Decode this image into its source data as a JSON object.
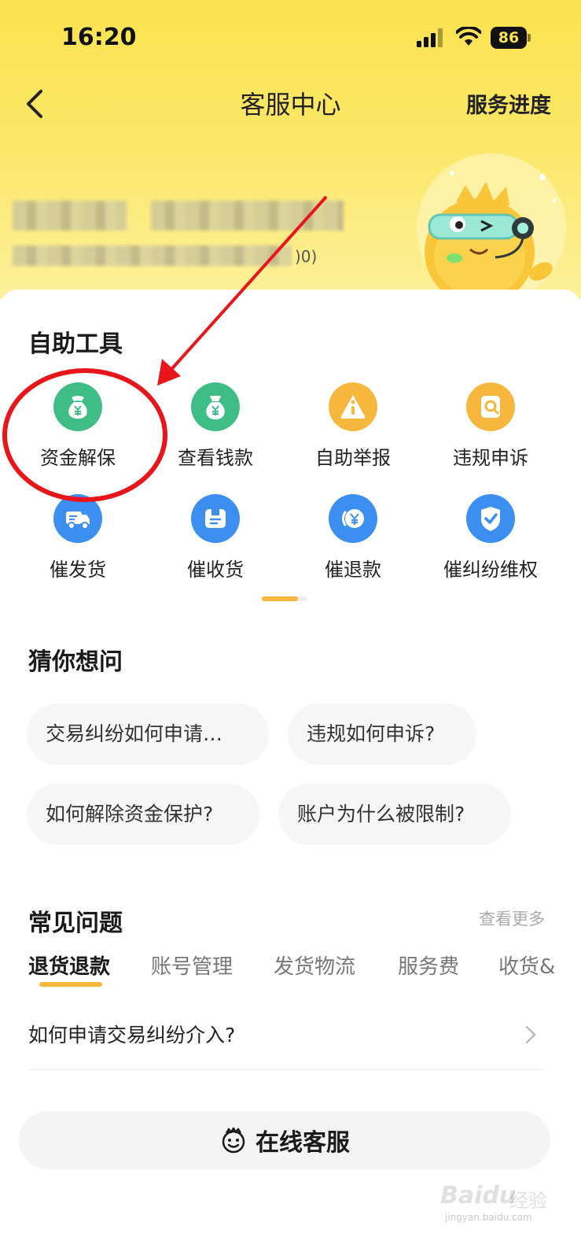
{
  "status_bar": {
    "time": "16:20",
    "battery": "86"
  },
  "nav": {
    "title": "客服中心",
    "right_action": "服务进度"
  },
  "account": {
    "blurred_suffix": ")0)"
  },
  "self_service": {
    "title": "自助工具",
    "tools": [
      {
        "label": "资金解保",
        "icon": "yuan-bag-icon",
        "color": "#3fbd87"
      },
      {
        "label": "查看钱款",
        "icon": "money-bag-icon",
        "color": "#3fbd87"
      },
      {
        "label": "自助举报",
        "icon": "info-icon",
        "color": "#f6b73c"
      },
      {
        "label": "违规申诉",
        "icon": "appeal-icon",
        "color": "#f6b73c"
      },
      {
        "label": "催发货",
        "icon": "truck-icon",
        "color": "#3c8ff0"
      },
      {
        "label": "催收货",
        "icon": "package-icon",
        "color": "#3c8ff0"
      },
      {
        "label": "催退款",
        "icon": "refund-icon",
        "color": "#3c8ff0"
      },
      {
        "label": "催纠纷维权",
        "icon": "check-icon",
        "color": "#3c8ff0"
      }
    ]
  },
  "guess": {
    "title": "猜你想问",
    "questions": [
      "交易纠纷如何申请…",
      "违规如何申诉?",
      "如何解除资金保护?",
      "账户为什么被限制?"
    ]
  },
  "faq": {
    "title": "常见问题",
    "more": "查看更多",
    "tabs": [
      "退货退款",
      "账号管理",
      "发货物流",
      "服务费",
      "收货&"
    ],
    "active_tab": 0,
    "items": [
      "如何申请交易纠纷介入?"
    ]
  },
  "online_service": {
    "label": "在线客服"
  },
  "watermark": {
    "brand": "Baidu",
    "suffix": "经验",
    "url": "jingyan.baidu.com"
  },
  "colors": {
    "accent": "#f6b73c",
    "header": "#fbe24f",
    "annotation": "#e8161b"
  }
}
